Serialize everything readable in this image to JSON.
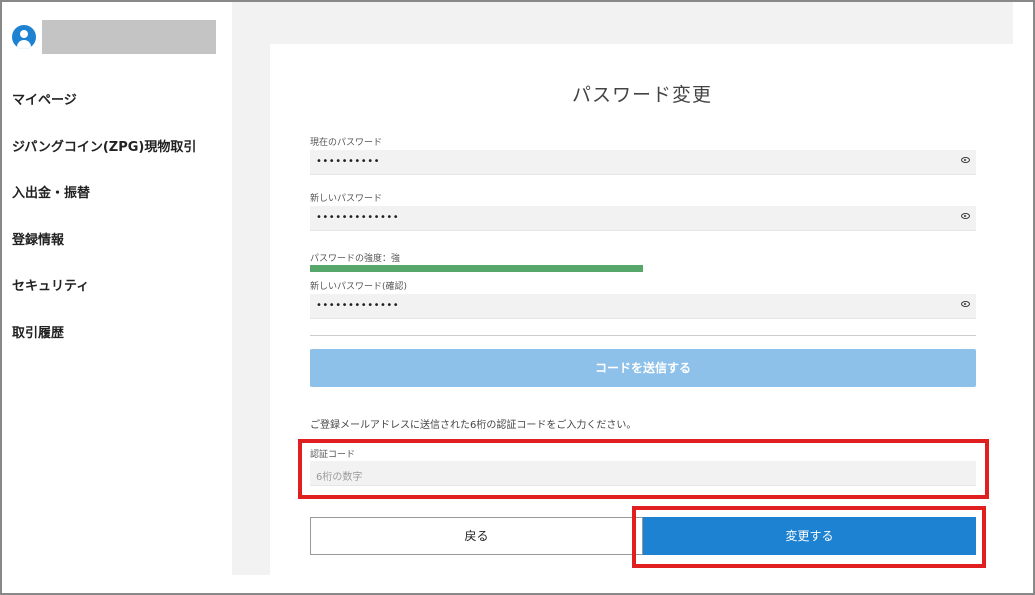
{
  "sidebar": {
    "items": [
      {
        "label": "マイページ"
      },
      {
        "label": "ジパングコイン(ZPG)現物取引"
      },
      {
        "label": "入出金・振替"
      },
      {
        "label": "登録情報"
      },
      {
        "label": "セキュリティ"
      },
      {
        "label": "取引履歴"
      }
    ]
  },
  "main": {
    "title": "パスワード変更",
    "current_password": {
      "label": "現在のパスワード",
      "value": "••••••••••"
    },
    "new_password": {
      "label": "新しいパスワード",
      "value": "•••••••••••••"
    },
    "strength": {
      "label": "パスワードの強度：強",
      "level": 0.5,
      "color": "#57a66a"
    },
    "confirm_password": {
      "label": "新しいパスワード(確認)",
      "value": "•••••••••••••"
    },
    "send_code_button": "コードを送信する",
    "info_text": "ご登録メールアドレスに送信された6桁の認証コードをご入力ください。",
    "auth_code": {
      "label": "認証コード",
      "placeholder": "6桁の数字"
    },
    "back_button": "戻る",
    "submit_button": "変更する"
  },
  "colors": {
    "accent": "#1e82d2",
    "disabled_button": "#8ec1ea",
    "highlight": "#e02020"
  }
}
